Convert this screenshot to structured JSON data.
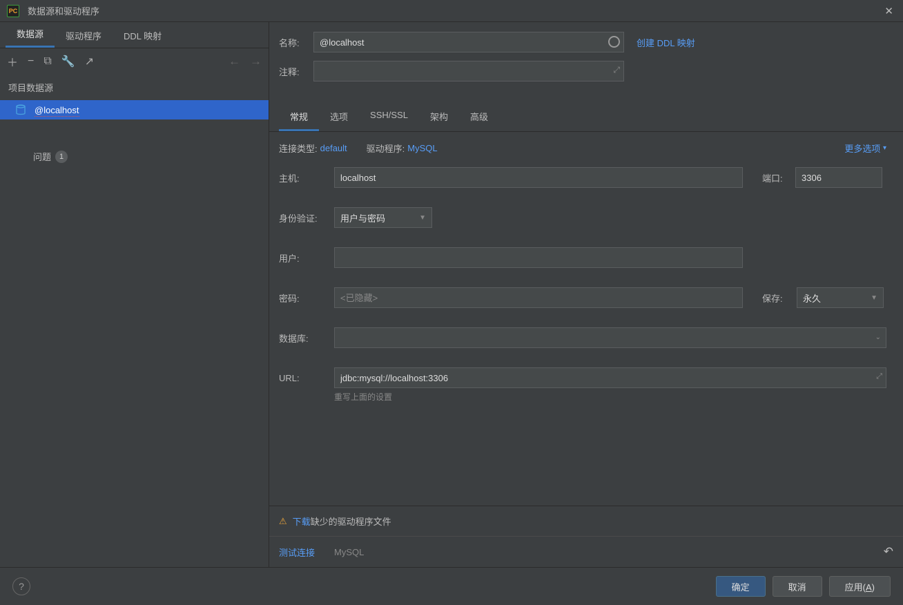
{
  "window": {
    "title": "数据源和驱动程序"
  },
  "leftTabs": {
    "t0": "数据源",
    "t1": "驱动程序",
    "t2": "DDL 映射"
  },
  "sectionHeader": "项目数据源",
  "datasource": {
    "name": "@localhost"
  },
  "problems": {
    "label": "问题",
    "count": "1"
  },
  "form": {
    "nameLabel": "名称:",
    "nameValue": "@localhost",
    "ddlLink": "创建 DDL 映射",
    "commentLabel": "注释:"
  },
  "subTabs": {
    "s0": "常规",
    "s1": "选项",
    "s2": "SSH/SSL",
    "s3": "架构",
    "s4": "高级"
  },
  "conn": {
    "typeLabel": "连接类型:",
    "typeValue": "default",
    "driverLabel": "驱动程序:",
    "driverValue": "MySQL",
    "more": "更多选项"
  },
  "fields": {
    "hostLabel": "主机:",
    "hostValue": "localhost",
    "portLabel": "端口:",
    "portValue": "3306",
    "authLabel": "身份验证:",
    "authValue": "用户与密码",
    "userLabel": "用户:",
    "pwdLabel": "密码:",
    "pwdPlaceholder": "<已隐藏>",
    "saveLabel": "保存:",
    "saveValue": "永久",
    "dbLabel": "数据库:",
    "urlLabel": "URL:",
    "urlValue": "jdbc:mysql://localhost:3306",
    "urlHint": "重写上面的设置"
  },
  "footer": {
    "download": "下载",
    "downloadRest": "缺少的驱动程序文件",
    "test": "测试连接",
    "mysql": "MySQL",
    "ok": "确定",
    "cancel": "取消",
    "applyPrefix": "应用(",
    "applyKey": "A",
    "applySuffix": ")"
  }
}
